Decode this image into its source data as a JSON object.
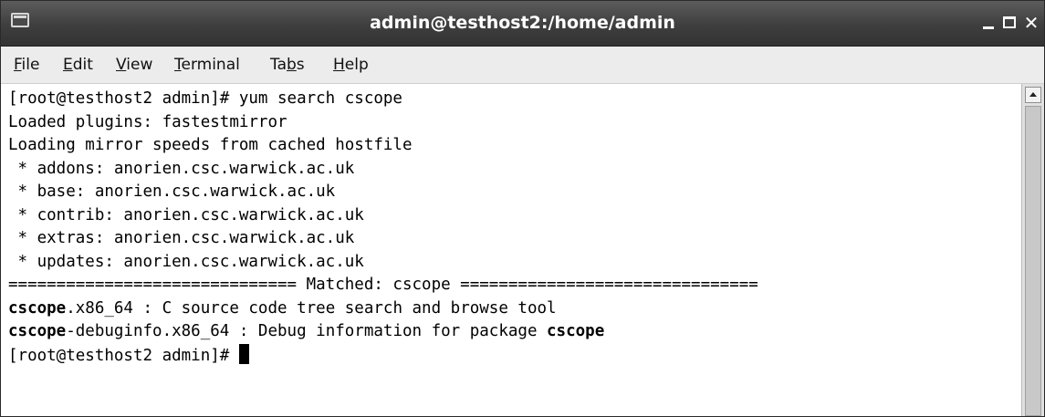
{
  "window": {
    "title": "admin@testhost2:/home/admin",
    "controls": {
      "minimize_icon": "minimize-icon",
      "maximize_icon": "maximize-icon",
      "close_icon": "close-icon"
    }
  },
  "menu": {
    "items": [
      {
        "pre": "",
        "key": "F",
        "post": "ile"
      },
      {
        "pre": "",
        "key": "E",
        "post": "dit"
      },
      {
        "pre": "",
        "key": "V",
        "post": "iew"
      },
      {
        "pre": "",
        "key": "T",
        "post": "erminal"
      },
      {
        "pre": "Ta",
        "key": "b",
        "post": "s"
      },
      {
        "pre": "",
        "key": "H",
        "post": "elp"
      }
    ]
  },
  "terminal": {
    "lines": [
      {
        "segments": [
          {
            "text": "[root@testhost2 admin]# yum search cscope",
            "bold": false
          }
        ]
      },
      {
        "segments": [
          {
            "text": "Loaded plugins: fastestmirror",
            "bold": false
          }
        ]
      },
      {
        "segments": [
          {
            "text": "Loading mirror speeds from cached hostfile",
            "bold": false
          }
        ]
      },
      {
        "segments": [
          {
            "text": " * addons: anorien.csc.warwick.ac.uk",
            "bold": false
          }
        ]
      },
      {
        "segments": [
          {
            "text": " * base: anorien.csc.warwick.ac.uk",
            "bold": false
          }
        ]
      },
      {
        "segments": [
          {
            "text": " * contrib: anorien.csc.warwick.ac.uk",
            "bold": false
          }
        ]
      },
      {
        "segments": [
          {
            "text": " * extras: anorien.csc.warwick.ac.uk",
            "bold": false
          }
        ]
      },
      {
        "segments": [
          {
            "text": " * updates: anorien.csc.warwick.ac.uk",
            "bold": false
          }
        ]
      },
      {
        "segments": [
          {
            "text": "============================== Matched: cscope ===============================",
            "bold": false
          }
        ]
      },
      {
        "segments": [
          {
            "text": "cscope",
            "bold": true
          },
          {
            "text": ".x86_64 : C source code tree search and browse tool",
            "bold": false
          }
        ]
      },
      {
        "segments": [
          {
            "text": "cscope",
            "bold": true
          },
          {
            "text": "-debuginfo.x86_64 : Debug information for package ",
            "bold": false
          },
          {
            "text": "cscope",
            "bold": true
          }
        ]
      },
      {
        "segments": [
          {
            "text": "[root@testhost2 admin]# ",
            "bold": false
          }
        ],
        "cursor": true
      }
    ]
  },
  "colors": {
    "titlebar": "#3e3e3e",
    "menubar": "#ececec",
    "terminal_bg": "#ffffff",
    "terminal_fg": "#000000"
  }
}
